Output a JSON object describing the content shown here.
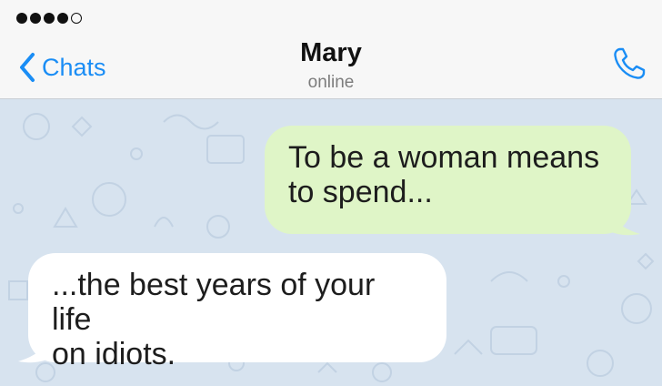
{
  "status_bar": {
    "signal_strength": 4,
    "signal_max": 5
  },
  "nav": {
    "back_label": "Chats",
    "contact_name": "Mary",
    "contact_status": "online"
  },
  "messages": [
    {
      "direction": "outgoing",
      "line1": "To be a woman means",
      "line2": "to spend..."
    },
    {
      "direction": "incoming",
      "line1": "...the best years of your life",
      "line2": "on idiots."
    }
  ],
  "colors": {
    "accent": "#1a8df5",
    "outgoing_bubble": "#dff5c7",
    "incoming_bubble": "#ffffff",
    "chat_background": "#d7e3ef"
  },
  "icons": [
    "chevron-left-icon",
    "phone-icon",
    "signal-dots-icon"
  ]
}
